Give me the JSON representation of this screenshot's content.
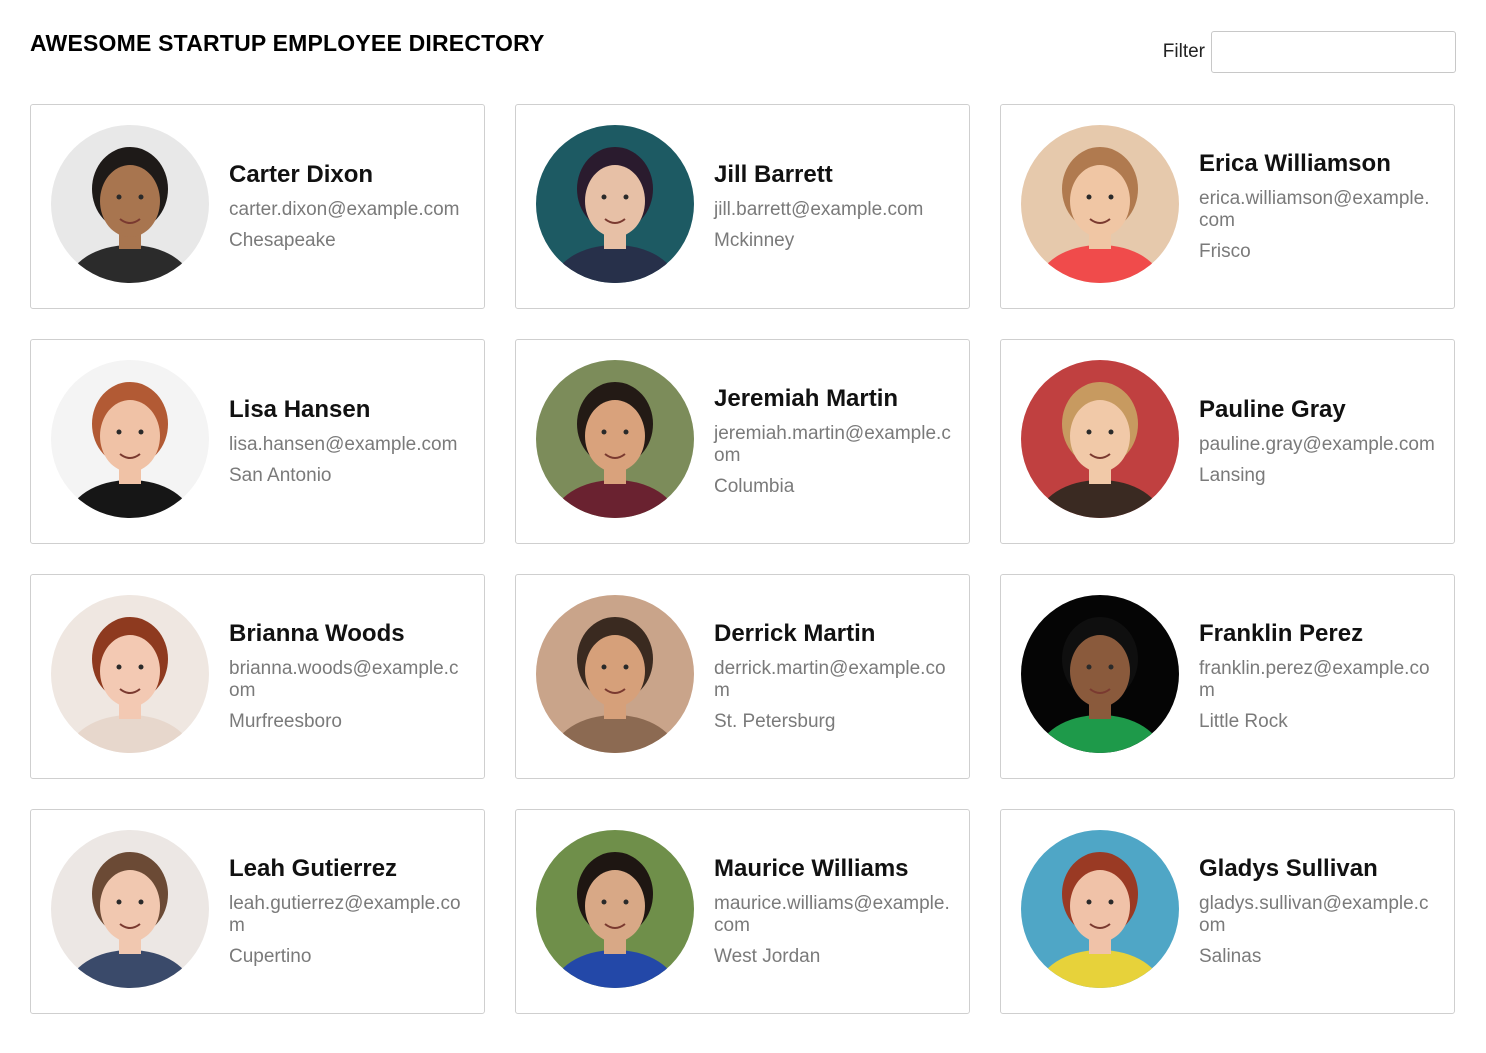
{
  "header": {
    "title": "AWESOME STARTUP EMPLOYEE DIRECTORY",
    "filter_label": "Filter",
    "filter_value": "",
    "filter_placeholder": ""
  },
  "employees": [
    {
      "name": "Carter Dixon",
      "email": "carter.dixon@example.com",
      "city": "Chesapeake",
      "photo": {
        "bg": "#e8e8e8",
        "skin": "#a8754f",
        "hair": "#1e1a18",
        "shirt": "#2b2b2b"
      }
    },
    {
      "name": "Jill Barrett",
      "email": "jill.barrett@example.com",
      "city": "Mckinney",
      "photo": {
        "bg": "#1d5a63",
        "skin": "#e7c0a6",
        "hair": "#2a1b2e",
        "shirt": "#27304a"
      }
    },
    {
      "name": "Erica Williamson",
      "email": "erica.williamson@example.com",
      "city": "Frisco",
      "photo": {
        "bg": "#e6c9ac",
        "skin": "#f0c6a4",
        "hair": "#b07a4f",
        "shirt": "#f04b4b"
      }
    },
    {
      "name": "Lisa Hansen",
      "email": "lisa.hansen@example.com",
      "city": "San Antonio",
      "photo": {
        "bg": "#f4f4f4",
        "skin": "#f0c2a6",
        "hair": "#b25a34",
        "shirt": "#161616"
      }
    },
    {
      "name": "Jeremiah Martin",
      "email": "jeremiah.martin@example.com",
      "city": "Columbia",
      "photo": {
        "bg": "#7c8c5a",
        "skin": "#d9a27c",
        "hair": "#231a15",
        "shirt": "#6a2230"
      }
    },
    {
      "name": "Pauline Gray",
      "email": "pauline.gray@example.com",
      "city": "Lansing",
      "photo": {
        "bg": "#c04040",
        "skin": "#f1c9a8",
        "hair": "#c79a60",
        "shirt": "#3a2a22"
      }
    },
    {
      "name": "Brianna Woods",
      "email": "brianna.woods@example.com",
      "city": "Murfreesboro",
      "photo": {
        "bg": "#efe7e1",
        "skin": "#f3c9b3",
        "hair": "#8e3a1f",
        "shirt": "#e7d7cc"
      }
    },
    {
      "name": "Derrick Martin",
      "email": "derrick.martin@example.com",
      "city": "St. Petersburg",
      "photo": {
        "bg": "#c9a48a",
        "skin": "#d6a07a",
        "hair": "#3a2a20",
        "shirt": "#8c6a52"
      }
    },
    {
      "name": "Franklin Perez",
      "email": "franklin.perez@example.com",
      "city": "Little Rock",
      "photo": {
        "bg": "#050505",
        "skin": "#8a5a3c",
        "hair": "#0f0f0f",
        "shirt": "#1e9a4a"
      }
    },
    {
      "name": "Leah Gutierrez",
      "email": "leah.gutierrez@example.com",
      "city": "Cupertino",
      "photo": {
        "bg": "#ece7e4",
        "skin": "#f1c8b0",
        "hair": "#6b4a35",
        "shirt": "#3a4a6a"
      }
    },
    {
      "name": "Maurice Williams",
      "email": "maurice.williams@example.com",
      "city": "West Jordan",
      "photo": {
        "bg": "#6f8f4a",
        "skin": "#d8a886",
        "hair": "#1e1612",
        "shirt": "#2348a8"
      }
    },
    {
      "name": "Gladys Sullivan",
      "email": "gladys.sullivan@example.com",
      "city": "Salinas",
      "photo": {
        "bg": "#4fa6c6",
        "skin": "#f0c2a8",
        "hair": "#9a3a24",
        "shirt": "#e7d23a"
      }
    }
  ]
}
